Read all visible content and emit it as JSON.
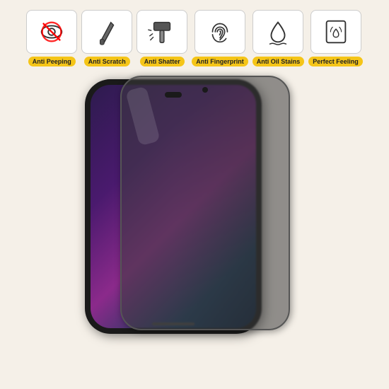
{
  "background_color": "#f5f0e8",
  "features": [
    {
      "id": "anti-peeping",
      "label": "Anti Peeping",
      "icon": "eye-slash"
    },
    {
      "id": "anti-scratch",
      "label": "Anti Scratch",
      "icon": "knife"
    },
    {
      "id": "anti-shatter",
      "label": "Anti Shatter",
      "icon": "hammer"
    },
    {
      "id": "anti-fingerprint",
      "label": "Anti Fingerprint",
      "icon": "fingerprint"
    },
    {
      "id": "anti-oil-stains",
      "label": "Anti Oil Stains",
      "icon": "water-drop"
    },
    {
      "id": "perfect-feeling",
      "label": "Perfect Feeling",
      "icon": "touch"
    }
  ],
  "label_bg_color": "#f5c518"
}
